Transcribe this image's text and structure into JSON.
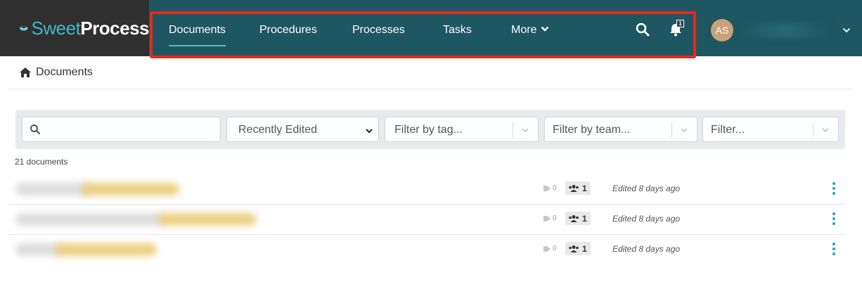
{
  "brand": {
    "sweet": "Sweet",
    "process": "Process"
  },
  "nav": {
    "items": [
      {
        "label": "Documents",
        "active": true
      },
      {
        "label": "Procedures",
        "active": false
      },
      {
        "label": "Processes",
        "active": false
      },
      {
        "label": "Tasks",
        "active": false
      },
      {
        "label": "More",
        "active": false
      }
    ],
    "notification_count": "1",
    "search_icon": "search-icon",
    "bell_icon": "bell-icon"
  },
  "user": {
    "initials": "AS"
  },
  "breadcrumb": {
    "label": "Documents",
    "icon": "home-icon"
  },
  "filters": {
    "search_placeholder": "",
    "sort_selected": "Recently Edited",
    "tag_placeholder": "Filter by tag...",
    "team_placeholder": "Filter by team...",
    "other_placeholder": "Filter..."
  },
  "documents": {
    "count_label": "21 documents",
    "rows": [
      {
        "tags": "0",
        "teams": "1",
        "edited": "Edited 8 days ago"
      },
      {
        "tags": "0",
        "teams": "1",
        "edited": "Edited 8 days ago"
      },
      {
        "tags": "0",
        "teams": "1",
        "edited": "Edited 8 days ago"
      }
    ]
  },
  "colors": {
    "topbar": "#1e5661",
    "logo_bg": "#2f2f2f",
    "brand_accent": "#3fb8c9",
    "highlight": "#e8291d",
    "kebab": "#2aa5b8",
    "avatar": "#c9a07a"
  }
}
